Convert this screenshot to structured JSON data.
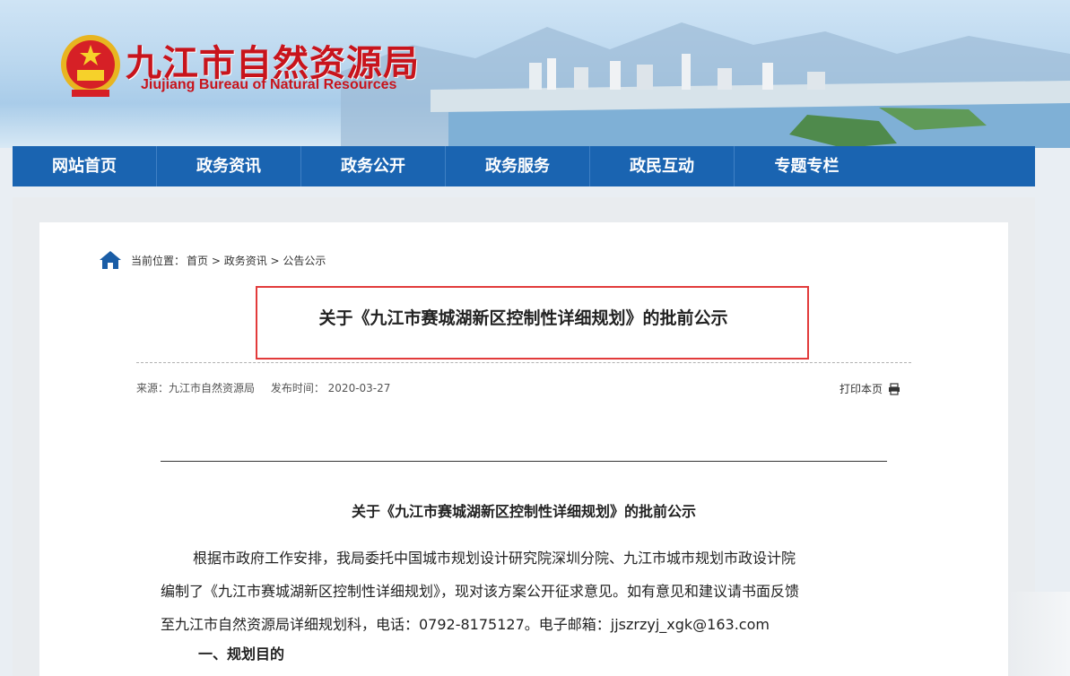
{
  "header": {
    "title": "九江市自然资源局",
    "subtitle": "Jiujiang Bureau of Natural Resources"
  },
  "nav": {
    "items": [
      {
        "label": "网站首页"
      },
      {
        "label": "政务资讯"
      },
      {
        "label": "政务公开"
      },
      {
        "label": "政务服务"
      },
      {
        "label": "政民互动"
      },
      {
        "label": "专题专栏"
      }
    ]
  },
  "breadcrumb": {
    "prefix": "当前位置：",
    "path": "首页 > 政务资讯 > 公告公示"
  },
  "article": {
    "title": "关于《九江市赛城湖新区控制性详细规划》的批前公示",
    "source": "来源：九江市自然资源局",
    "publish_time": "发布时间： 2020-03-27",
    "print_label": "打印本页",
    "doc_title": "关于《九江市赛城湖新区控制性详细规划》的批前公示",
    "para_lines": [
      "根据市政府工作安排，我局委托中国城市规划设计研究院深圳分院、九江市城市规划市政设计院",
      "编制了《九江市赛城湖新区控制性详细规划》，现对该方案公开征求意见。如有意见和建议请书面反馈",
      "至九江市自然资源局详细规划科，电话：0792-8175127。电子邮箱：jjszrzyj_xgk@163.com"
    ],
    "section1": "一、规划目的"
  },
  "colors": {
    "brand_red": "#c8141c",
    "nav_blue": "#1a64b1",
    "highlight_border": "#e23b3b"
  }
}
